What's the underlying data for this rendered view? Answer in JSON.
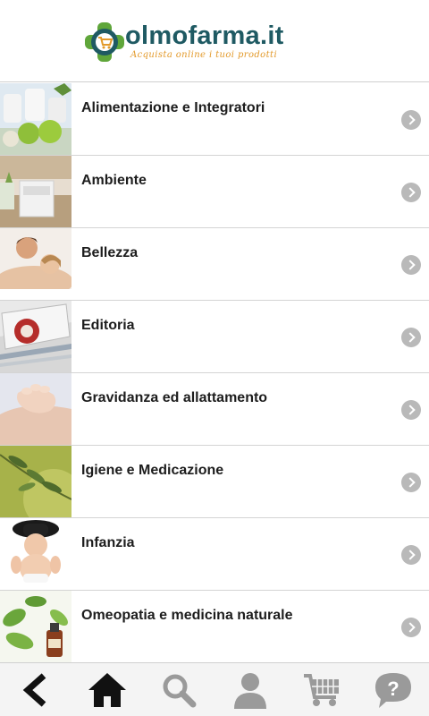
{
  "header": {
    "logo_name": "olmofarma.it",
    "logo_tagline": "Acquista online i tuoi prodotti",
    "logo_icon": "pharmacy-cross-cart-logo"
  },
  "categories": [
    {
      "label": "Alimentazione e Integratori",
      "thumb": "supplements-apples-photo"
    },
    {
      "label": "Ambiente",
      "thumb": "kitchen-appliance-photo"
    },
    {
      "label": "Bellezza",
      "thumb": "couple-skin-care-photo"
    },
    {
      "label": "Editoria",
      "thumb": "magazines-photo"
    },
    {
      "label": "Gravidanza ed allattamento",
      "thumb": "baby-hand-photo"
    },
    {
      "label": "Igiene e Medicazione",
      "thumb": "olive-branch-photo"
    },
    {
      "label": "Infanzia",
      "thumb": "baby-with-hat-photo"
    },
    {
      "label": "Omeopatia e medicina naturale",
      "thumb": "herbs-bottle-photo"
    }
  ],
  "tabbar": {
    "items": [
      "back-icon",
      "home-icon",
      "search-icon",
      "account-icon",
      "cart-icon",
      "help-icon"
    ]
  },
  "colors": {
    "brand_teal": "#1f5a63",
    "brand_green": "#5fa63a",
    "brand_orange": "#e39a2b",
    "chevron": "#b9b9b9",
    "tab_icon_dark": "#111111",
    "tab_icon_grey": "#9a9a9a"
  }
}
